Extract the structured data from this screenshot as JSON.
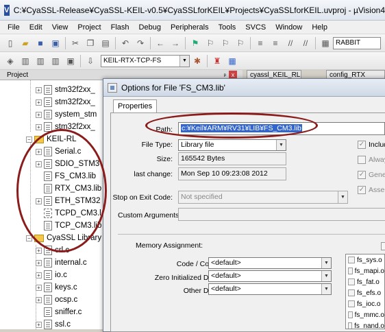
{
  "window": {
    "title": "C:¥CyaSSL-Release¥CyaSSL-KEIL-v0.5¥CyaSSLforKEIL¥Projects¥CyaSSLforKEIL.uvproj - µVision4",
    "app_icon": "V"
  },
  "menu": [
    "File",
    "Edit",
    "View",
    "Project",
    "Flash",
    "Debug",
    "Peripherals",
    "Tools",
    "SVCS",
    "Window",
    "Help"
  ],
  "toolbar": {
    "target": "KEIL-RTX-TCP-FS",
    "find_text": "RABBIT"
  },
  "project_panel": {
    "title": "Project",
    "pin": "ᵖ",
    "close": "x"
  },
  "tree": [
    {
      "label": "stm32f2xx_",
      "type": "file",
      "expand": "+"
    },
    {
      "label": "stm32f2xx_",
      "type": "file",
      "expand": "+"
    },
    {
      "label": "system_stm",
      "type": "file",
      "expand": "+"
    },
    {
      "label": "stm32f2xx_",
      "type": "file",
      "expand": "+"
    },
    {
      "label": "KEIL-RL",
      "type": "folder",
      "expand": "−"
    },
    {
      "label": "Serial.c",
      "type": "file",
      "expand": "+"
    },
    {
      "label": "SDIO_STM3",
      "type": "file",
      "expand": "+"
    },
    {
      "label": "FS_CM3.lib",
      "type": "file",
      "expand": ""
    },
    {
      "label": "RTX_CM3.lib",
      "type": "file",
      "expand": ""
    },
    {
      "label": "ETH_STM32",
      "type": "file",
      "expand": "+"
    },
    {
      "label": "TCPD_CM3.l",
      "type": "file",
      "expand": ""
    },
    {
      "label": "TCP_CM3.lib",
      "type": "file",
      "expand": ""
    },
    {
      "label": "CyaSSL Library",
      "type": "folder",
      "expand": "−"
    },
    {
      "label": "crl.c",
      "type": "file",
      "expand": "+"
    },
    {
      "label": "internal.c",
      "type": "file",
      "expand": "+"
    },
    {
      "label": "io.c",
      "type": "file",
      "expand": "+"
    },
    {
      "label": "keys.c",
      "type": "file",
      "expand": "+"
    },
    {
      "label": "ocsp.c",
      "type": "file",
      "expand": "+"
    },
    {
      "label": "sniffer.c",
      "type": "file",
      "expand": ""
    },
    {
      "label": "ssl.c",
      "type": "file",
      "expand": "+"
    }
  ],
  "doc_tabs": [
    "cyassl_KEIL_RL.c",
    "config_RTX"
  ],
  "dialog": {
    "title": "Options for File 'FS_CM3.lib'",
    "tab": "Properties",
    "path_label": "Path:",
    "path_value": "c:¥Keil¥ARM¥RV31¥LIB¥FS_CM3.lib",
    "filetype_label": "File Type:",
    "filetype_value": "Library file",
    "size_label": "Size:",
    "size_value": "165542 Bytes",
    "lastchange_label": "last change:",
    "lastchange_value": "Mon Sep 10 09:23:08 2012",
    "stop_label": "Stop on Exit Code:",
    "stop_value": "Not specified",
    "custom_label": "Custom Arguments:",
    "memory_label": "Memory Assignment:",
    "code_label": "Code / Const:",
    "code_value": "<default>",
    "zero_label": "Zero Initialized Data:",
    "zero_value": "<default>",
    "other_label": "Other Data:",
    "other_value": "<default>",
    "checks": [
      "Includ",
      "Alway",
      "Gener",
      "Assem"
    ],
    "lib_list": [
      "fs_sys.o",
      "fs_mapi.o",
      "fs_fat.o",
      "fs_efs.o",
      "fs_ioc.o",
      "fs_mmc.o",
      "fs_nand.o"
    ]
  }
}
